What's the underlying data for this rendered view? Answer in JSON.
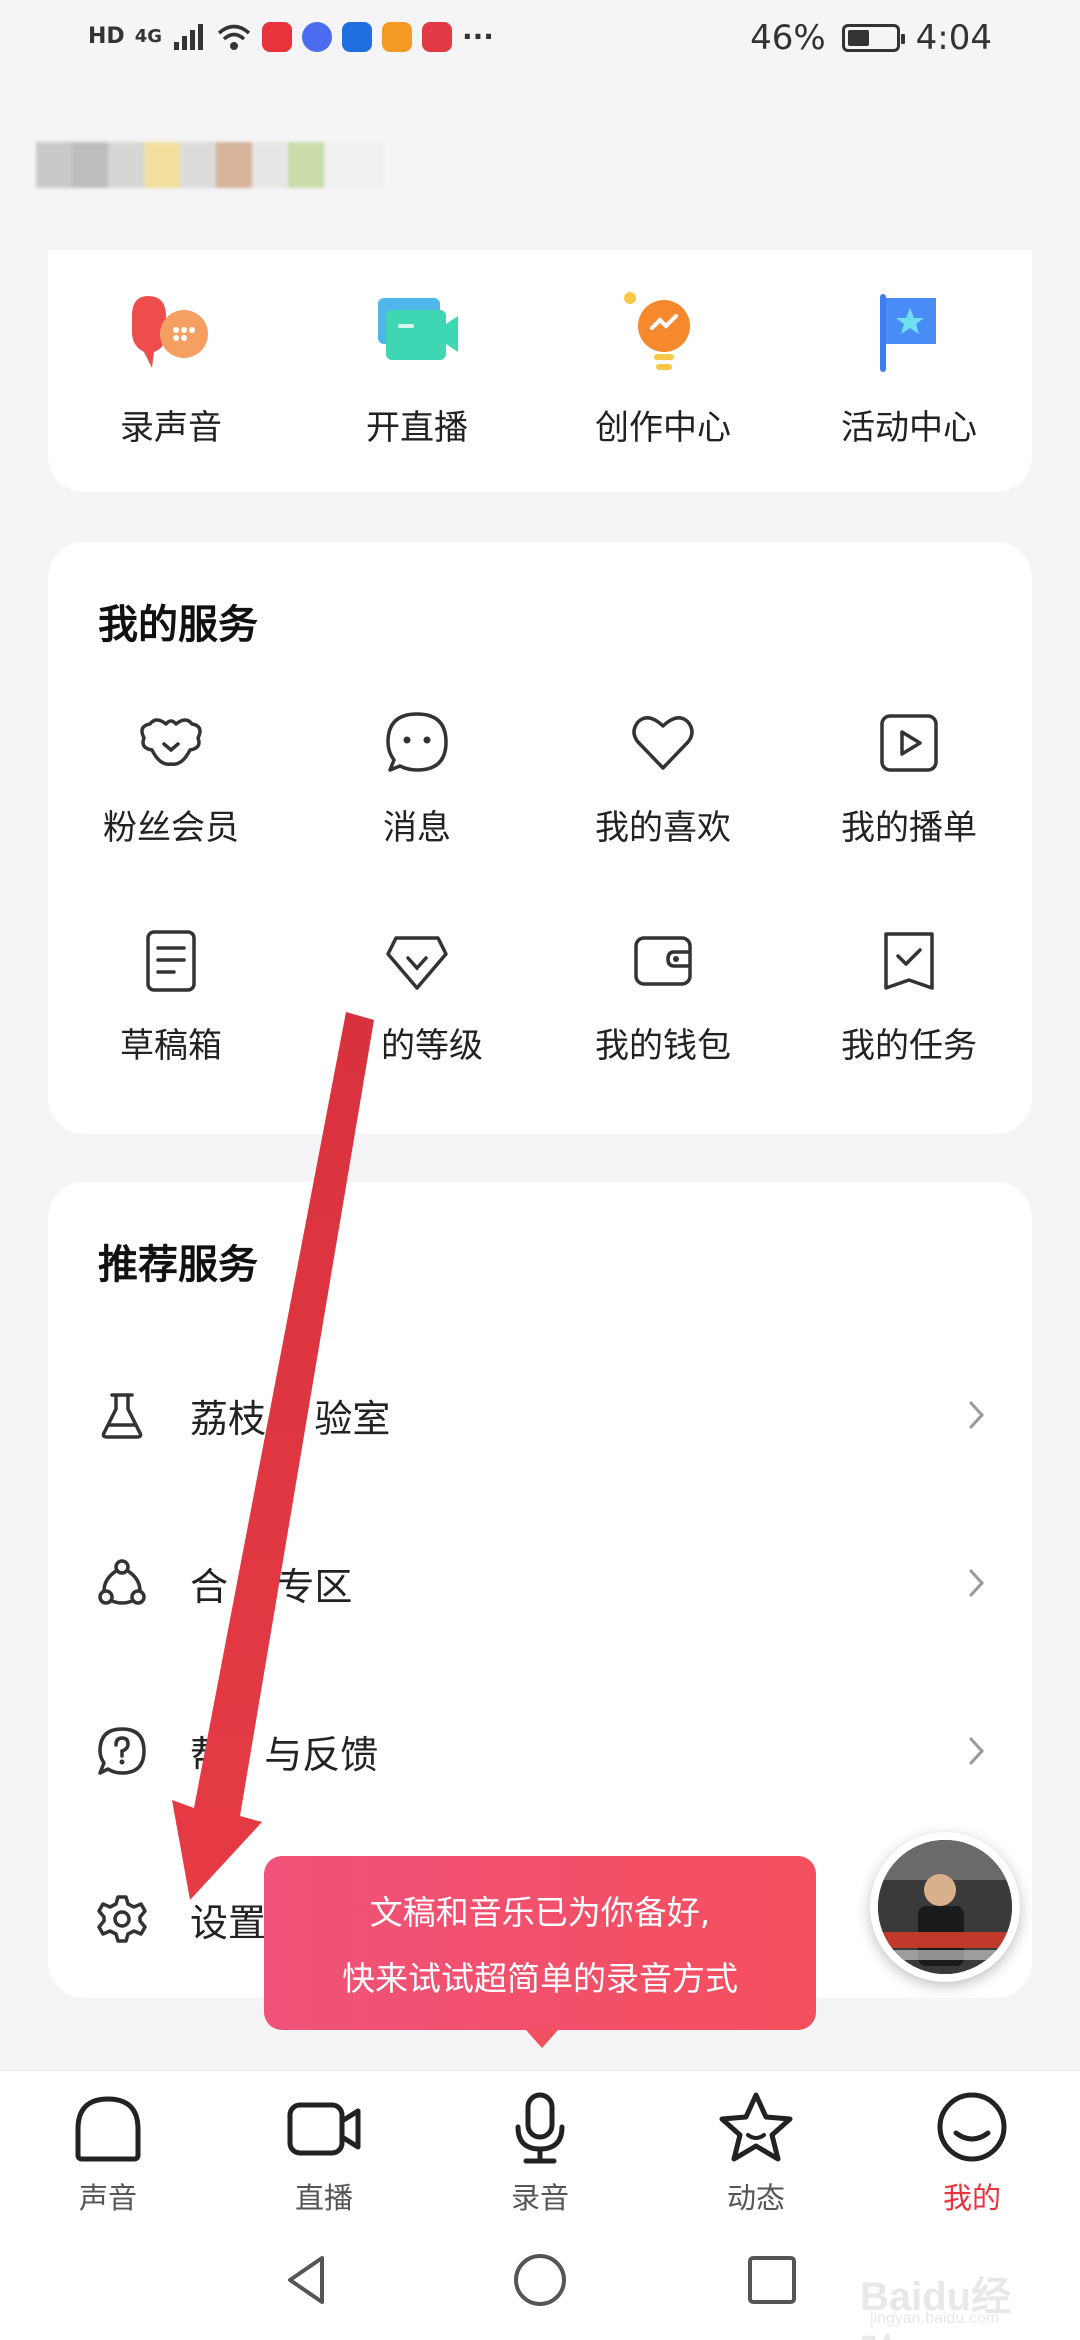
{
  "status_bar": {
    "hd_label": "HD",
    "network_label": "4G",
    "battery_text": "46%",
    "battery_level": 0.46,
    "time": "4:04",
    "more": "···"
  },
  "quick_actions": [
    {
      "label": "录声音",
      "icon": "record-voice-icon"
    },
    {
      "label": "开直播",
      "icon": "live-camera-icon"
    },
    {
      "label": "创作中心",
      "icon": "lightbulb-icon"
    },
    {
      "label": "活动中心",
      "icon": "flag-star-icon"
    }
  ],
  "my_services": {
    "title": "我的服务",
    "items": [
      {
        "label": "粉丝会员",
        "icon": "wings-heart-icon"
      },
      {
        "label": "消息",
        "icon": "chat-bubble-icon"
      },
      {
        "label": "我的喜欢",
        "icon": "heart-icon"
      },
      {
        "label": "我的播单",
        "icon": "play-box-icon"
      },
      {
        "label": "草稿箱",
        "icon": "document-icon"
      },
      {
        "label": "的等级",
        "icon": "diamond-icon"
      },
      {
        "label": "我的钱包",
        "icon": "wallet-icon"
      },
      {
        "label": "我的任务",
        "icon": "task-check-icon"
      }
    ]
  },
  "recommended": {
    "title": "推荐服务",
    "items": [
      {
        "label": "荔枝    验室",
        "icon": "flask-icon"
      },
      {
        "label": "合    专区",
        "icon": "share-nodes-icon"
      },
      {
        "label": "帮   与反馈",
        "icon": "help-chat-icon"
      },
      {
        "label": "设置",
        "icon": "gear-icon"
      }
    ]
  },
  "tooltip": {
    "line1": "文稿和音乐已为你备好,",
    "line2": "快来试试超简单的录音方式"
  },
  "bottom_nav": [
    {
      "label": "声音",
      "icon": "home-icon",
      "active": false
    },
    {
      "label": "直播",
      "icon": "video-icon",
      "active": false
    },
    {
      "label": "录音",
      "icon": "microphone-icon",
      "active": false
    },
    {
      "label": "动态",
      "icon": "star-icon",
      "active": false
    },
    {
      "label": "我的",
      "icon": "profile-face-icon",
      "active": true
    }
  ],
  "colors": {
    "accent": "#e8323c",
    "tooltip": "#f3505f",
    "arrow": "#e23a44"
  },
  "watermark": {
    "brand": "Baidu经验",
    "url": "jingyan.baidu.com"
  }
}
